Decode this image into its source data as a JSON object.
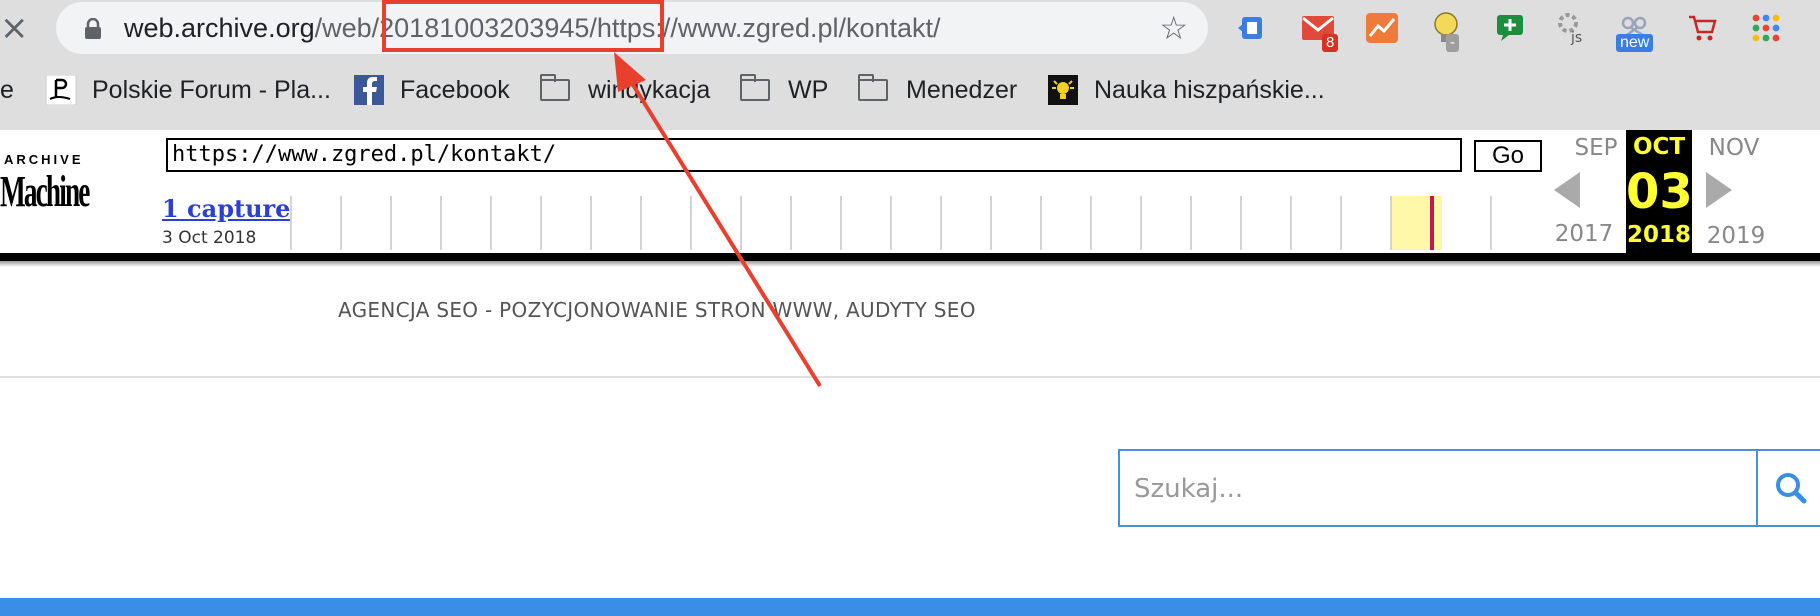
{
  "browser": {
    "url_host": "web.archive.org",
    "url_rest": "/web/20181003203945/https://www.zgred.pl/kontakt/",
    "close_glyph": "×",
    "star_glyph": "☆",
    "extensions": [
      {
        "icon": "extension-blue-icon"
      },
      {
        "icon": "gmail-icon",
        "badge": "8"
      },
      {
        "icon": "analytics-icon"
      },
      {
        "icon": "lightbulb-icon",
        "badge": "-"
      },
      {
        "icon": "chat-plus-icon"
      },
      {
        "icon": "js-gear-icon",
        "label": "js"
      },
      {
        "icon": "scissors-icon",
        "badge": "new"
      },
      {
        "icon": "cart-icon"
      },
      {
        "icon": "apps-grid-icon"
      }
    ]
  },
  "bookmarks": [
    {
      "label": "e"
    },
    {
      "label": "Polskie Forum - Pla...",
      "icon": "playstation-icon"
    },
    {
      "label": "Facebook",
      "icon": "facebook-icon"
    },
    {
      "label": "windykacja",
      "icon": "folder-icon"
    },
    {
      "label": "WP",
      "icon": "folder-icon"
    },
    {
      "label": "Menedzer",
      "icon": "folder-icon"
    },
    {
      "label": "Nauka hiszpańskie...",
      "icon": "lightbulb-favicon-icon"
    }
  ],
  "wayback": {
    "logo_top": "ARCHIVE",
    "logo_bottom": "Machine",
    "url_value": "https://www.zgred.pl/kontakt/",
    "go_label": "Go",
    "captures_label": "1 capture",
    "capture_date": "3 Oct 2018",
    "prev_month": "SEP",
    "prev_year": "2017",
    "current_month": "OCT",
    "current_day": "03",
    "current_year": "2018",
    "next_month": "NOV",
    "next_year": "2019"
  },
  "page": {
    "site_title": "AGENCJA SEO - POZYCJONOWANIE STRON WWW, AUDYTY SEO",
    "search_placeholder": "Szukaj...",
    "accent_color": "#3a8ee6"
  },
  "annotation": {
    "color": "#e8402f"
  }
}
